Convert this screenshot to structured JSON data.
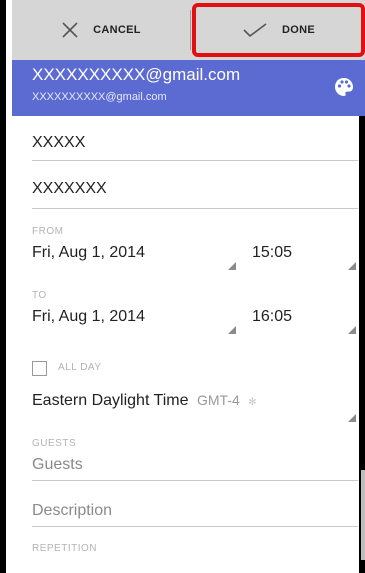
{
  "toolbar": {
    "cancel_label": "CANCEL",
    "done_label": "DONE"
  },
  "account": {
    "primary": "XXXXXXXXXX@gmail.com",
    "secondary": "XXXXXXXXXX@gmail.com",
    "icon": "palette-icon"
  },
  "event": {
    "title": "XXXXX",
    "location": "XXXXXXX"
  },
  "from": {
    "label": "FROM",
    "date": "Fri, Aug 1, 2014",
    "time": "15:05"
  },
  "to": {
    "label": "TO",
    "date": "Fri, Aug 1, 2014",
    "time": "16:05"
  },
  "all_day": {
    "label": "ALL DAY",
    "checked": false
  },
  "timezone": {
    "name": "Eastern Daylight Time",
    "offset": "GMT-4"
  },
  "guests": {
    "label": "GUESTS",
    "placeholder": "Guests"
  },
  "description": {
    "placeholder": "Description"
  },
  "repetition": {
    "label": "REPETITION"
  },
  "colors": {
    "accent": "#5c6bd1",
    "toolbar": "#d6d6d6",
    "highlight": "#e01010"
  }
}
